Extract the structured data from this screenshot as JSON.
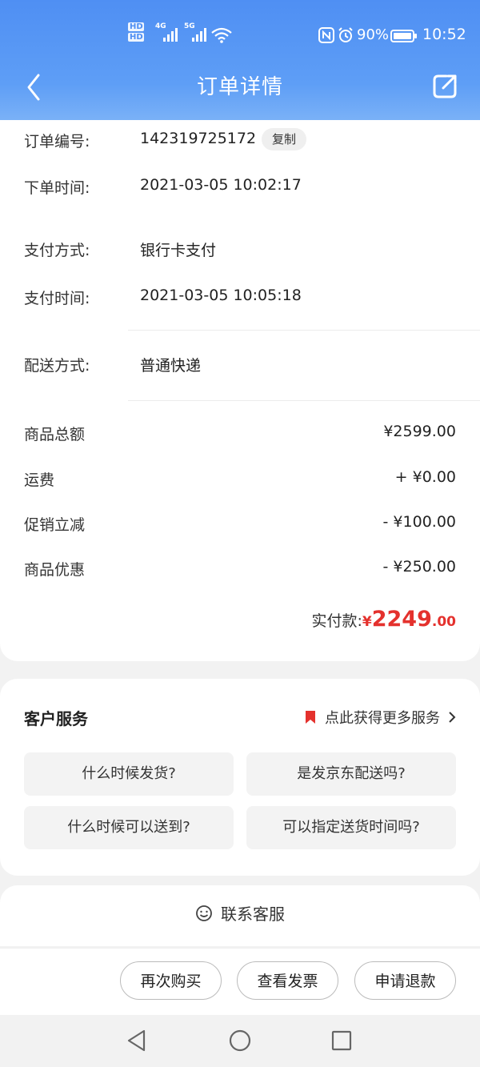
{
  "status_bar": {
    "hd1": "HD",
    "hd2": "HD",
    "signal1_label": "4G",
    "signal2_label": "5G",
    "battery_percent": "90%",
    "time": "10:52",
    "icons": [
      "signal-icon",
      "wifi-icon",
      "nfc-icon",
      "alarm-icon",
      "battery-icon"
    ]
  },
  "nav": {
    "title": "订单详情",
    "back_icon": "chevron-left-icon",
    "share_icon": "share-icon"
  },
  "order_info": {
    "order_no_label": "订单编号:",
    "order_no": "142319725172",
    "copy_label": "复制",
    "order_time_label": "下单时间:",
    "order_time": "2021-03-05 10:02:17",
    "pay_method_label": "支付方式:",
    "pay_method": "银行卡支付",
    "pay_time_label": "支付时间:",
    "pay_time": "2021-03-05 10:05:18",
    "delivery_label": "配送方式:",
    "delivery": "普通快递"
  },
  "fees": [
    {
      "label": "商品总额",
      "value": "¥2599.00"
    },
    {
      "label": "运费",
      "value": "+ ¥0.00"
    },
    {
      "label": "促销立减",
      "value": "- ¥100.00"
    },
    {
      "label": "商品优惠",
      "value": "- ¥250.00"
    }
  ],
  "total": {
    "label": "实付款:",
    "currency": "¥",
    "integer": "2249",
    "decimal": ".00",
    "color": "#e4312d"
  },
  "service": {
    "title": "客户服务",
    "more_label": "点此获得更多服务",
    "questions": [
      "什么时候发货?",
      "是发京东配送吗?",
      "什么时候可以送到?",
      "可以指定送货时间吗?"
    ]
  },
  "contact": {
    "label": "联系客服"
  },
  "actions": {
    "buy_again": "再次购买",
    "view_invoice": "查看发票",
    "refund": "申请退款"
  },
  "colors": {
    "header_blue": "#4f8ff3",
    "accent_red": "#e4312d"
  }
}
